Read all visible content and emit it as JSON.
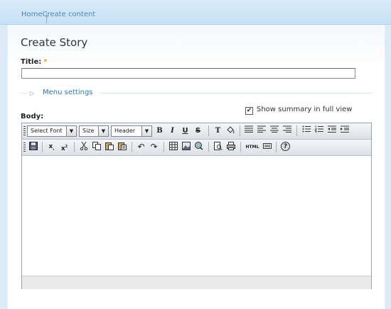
{
  "breadcrumb": {
    "home": "Home",
    "separator": "›",
    "current": "Create content"
  },
  "page": {
    "title": "Create Story"
  },
  "form": {
    "title_label": "Title:",
    "required_mark": "*",
    "title_value": "",
    "menu_settings_label": "Menu settings",
    "body_label": "Body:",
    "show_summary_label": "Show summary in full view",
    "show_summary_checked": true
  },
  "editor": {
    "font_select": "Select Font",
    "size_select": "Size",
    "format_select": "Header",
    "row1_buttons": [
      "bold",
      "italic",
      "underline",
      "strikethrough",
      "text-color",
      "background-color",
      "align-justify",
      "align-left",
      "align-center",
      "align-right",
      "bullet-list",
      "numbered-list",
      "outdent",
      "indent"
    ],
    "row2_buttons": [
      "save",
      "subscript",
      "superscript",
      "cut",
      "copy",
      "paste",
      "paste-text",
      "undo",
      "redo",
      "table",
      "image",
      "link",
      "preview",
      "print",
      "html",
      "source",
      "help"
    ],
    "labels": {
      "bold": "B",
      "italic": "I",
      "underline": "U",
      "strike": "S",
      "text_color": "T",
      "subscript": "x",
      "superscript": "x",
      "html": "HTML",
      "help": "?"
    }
  },
  "colors": {
    "accent": "#2a78b4",
    "topbar": "#c6e1f5",
    "required": "#f0a000"
  }
}
